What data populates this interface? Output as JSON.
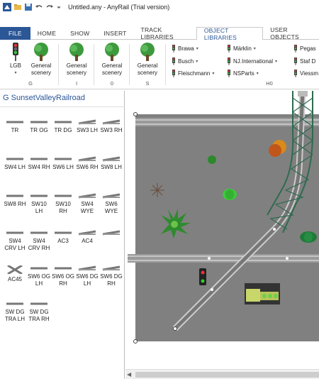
{
  "window": {
    "title": "Untitled.any - AnyRail (Trial version)"
  },
  "quick_access": [
    "app-icon",
    "open-icon",
    "save-icon",
    "undo-icon",
    "redo-icon",
    "customize-icon"
  ],
  "tabs": [
    {
      "label": "FILE"
    },
    {
      "label": "HOME"
    },
    {
      "label": "SHOW"
    },
    {
      "label": "INSERT"
    },
    {
      "label": "TRACK LIBRARIES"
    },
    {
      "label": "OBJECT LIBRARIES"
    },
    {
      "label": "USER OBJECTS"
    }
  ],
  "ribbon": {
    "buttons": [
      {
        "label": "LGB",
        "icon": "signal-icon"
      },
      {
        "label": "General scenery",
        "icon": "tree-icon"
      },
      {
        "label": "General scenery",
        "icon": "tree-icon"
      },
      {
        "label": "General scenery",
        "icon": "tree-icon"
      },
      {
        "label": "General scenery",
        "icon": "tree-icon"
      }
    ],
    "group_labels": [
      "G",
      "I",
      "0",
      "S"
    ],
    "manufacturers": [
      {
        "label": "Brawa"
      },
      {
        "label": "Busch"
      },
      {
        "label": "Fleischmann"
      },
      {
        "label": "Märklin"
      },
      {
        "label": "NJ.International"
      },
      {
        "label": "NSParts"
      },
      {
        "label": "Pegas"
      },
      {
        "label": "Staf D"
      },
      {
        "label": "Viessm"
      }
    ],
    "group_label_h0": "H0"
  },
  "library_panel": {
    "title": "G SunsetValleyRailroad",
    "tracks": [
      {
        "label": "TR"
      },
      {
        "label": "TR OG"
      },
      {
        "label": "TR DG"
      },
      {
        "label": "SW3 LH"
      },
      {
        "label": "SW3 RH"
      },
      {
        "label": "SW4 LH"
      },
      {
        "label": "SW4 RH"
      },
      {
        "label": "SW6 LH"
      },
      {
        "label": "SW6 RH"
      },
      {
        "label": "SW8 LH"
      },
      {
        "label": "SW8 RH"
      },
      {
        "label": "SW10 LH"
      },
      {
        "label": "SW10 RH"
      },
      {
        "label": "SW4 WYE"
      },
      {
        "label": "SW6 WYE"
      },
      {
        "label": "SW4 CRV LH"
      },
      {
        "label": "SW4 CRV RH"
      },
      {
        "label": "AC3"
      },
      {
        "label": "AC4"
      },
      {
        "label": ""
      },
      {
        "label": "AC45"
      },
      {
        "label": "SW6 OG LH"
      },
      {
        "label": "SW6 OG RH"
      },
      {
        "label": "SW6 DG LH"
      },
      {
        "label": "SW6 DG RH"
      },
      {
        "label": "SW DG TRA LH"
      },
      {
        "label": "SW DG TRA RH"
      }
    ]
  },
  "colors": {
    "accent": "#2b5797",
    "baseboard": "#808080",
    "tree": "#3c9a3c",
    "bridge": "#2e6b4f"
  }
}
